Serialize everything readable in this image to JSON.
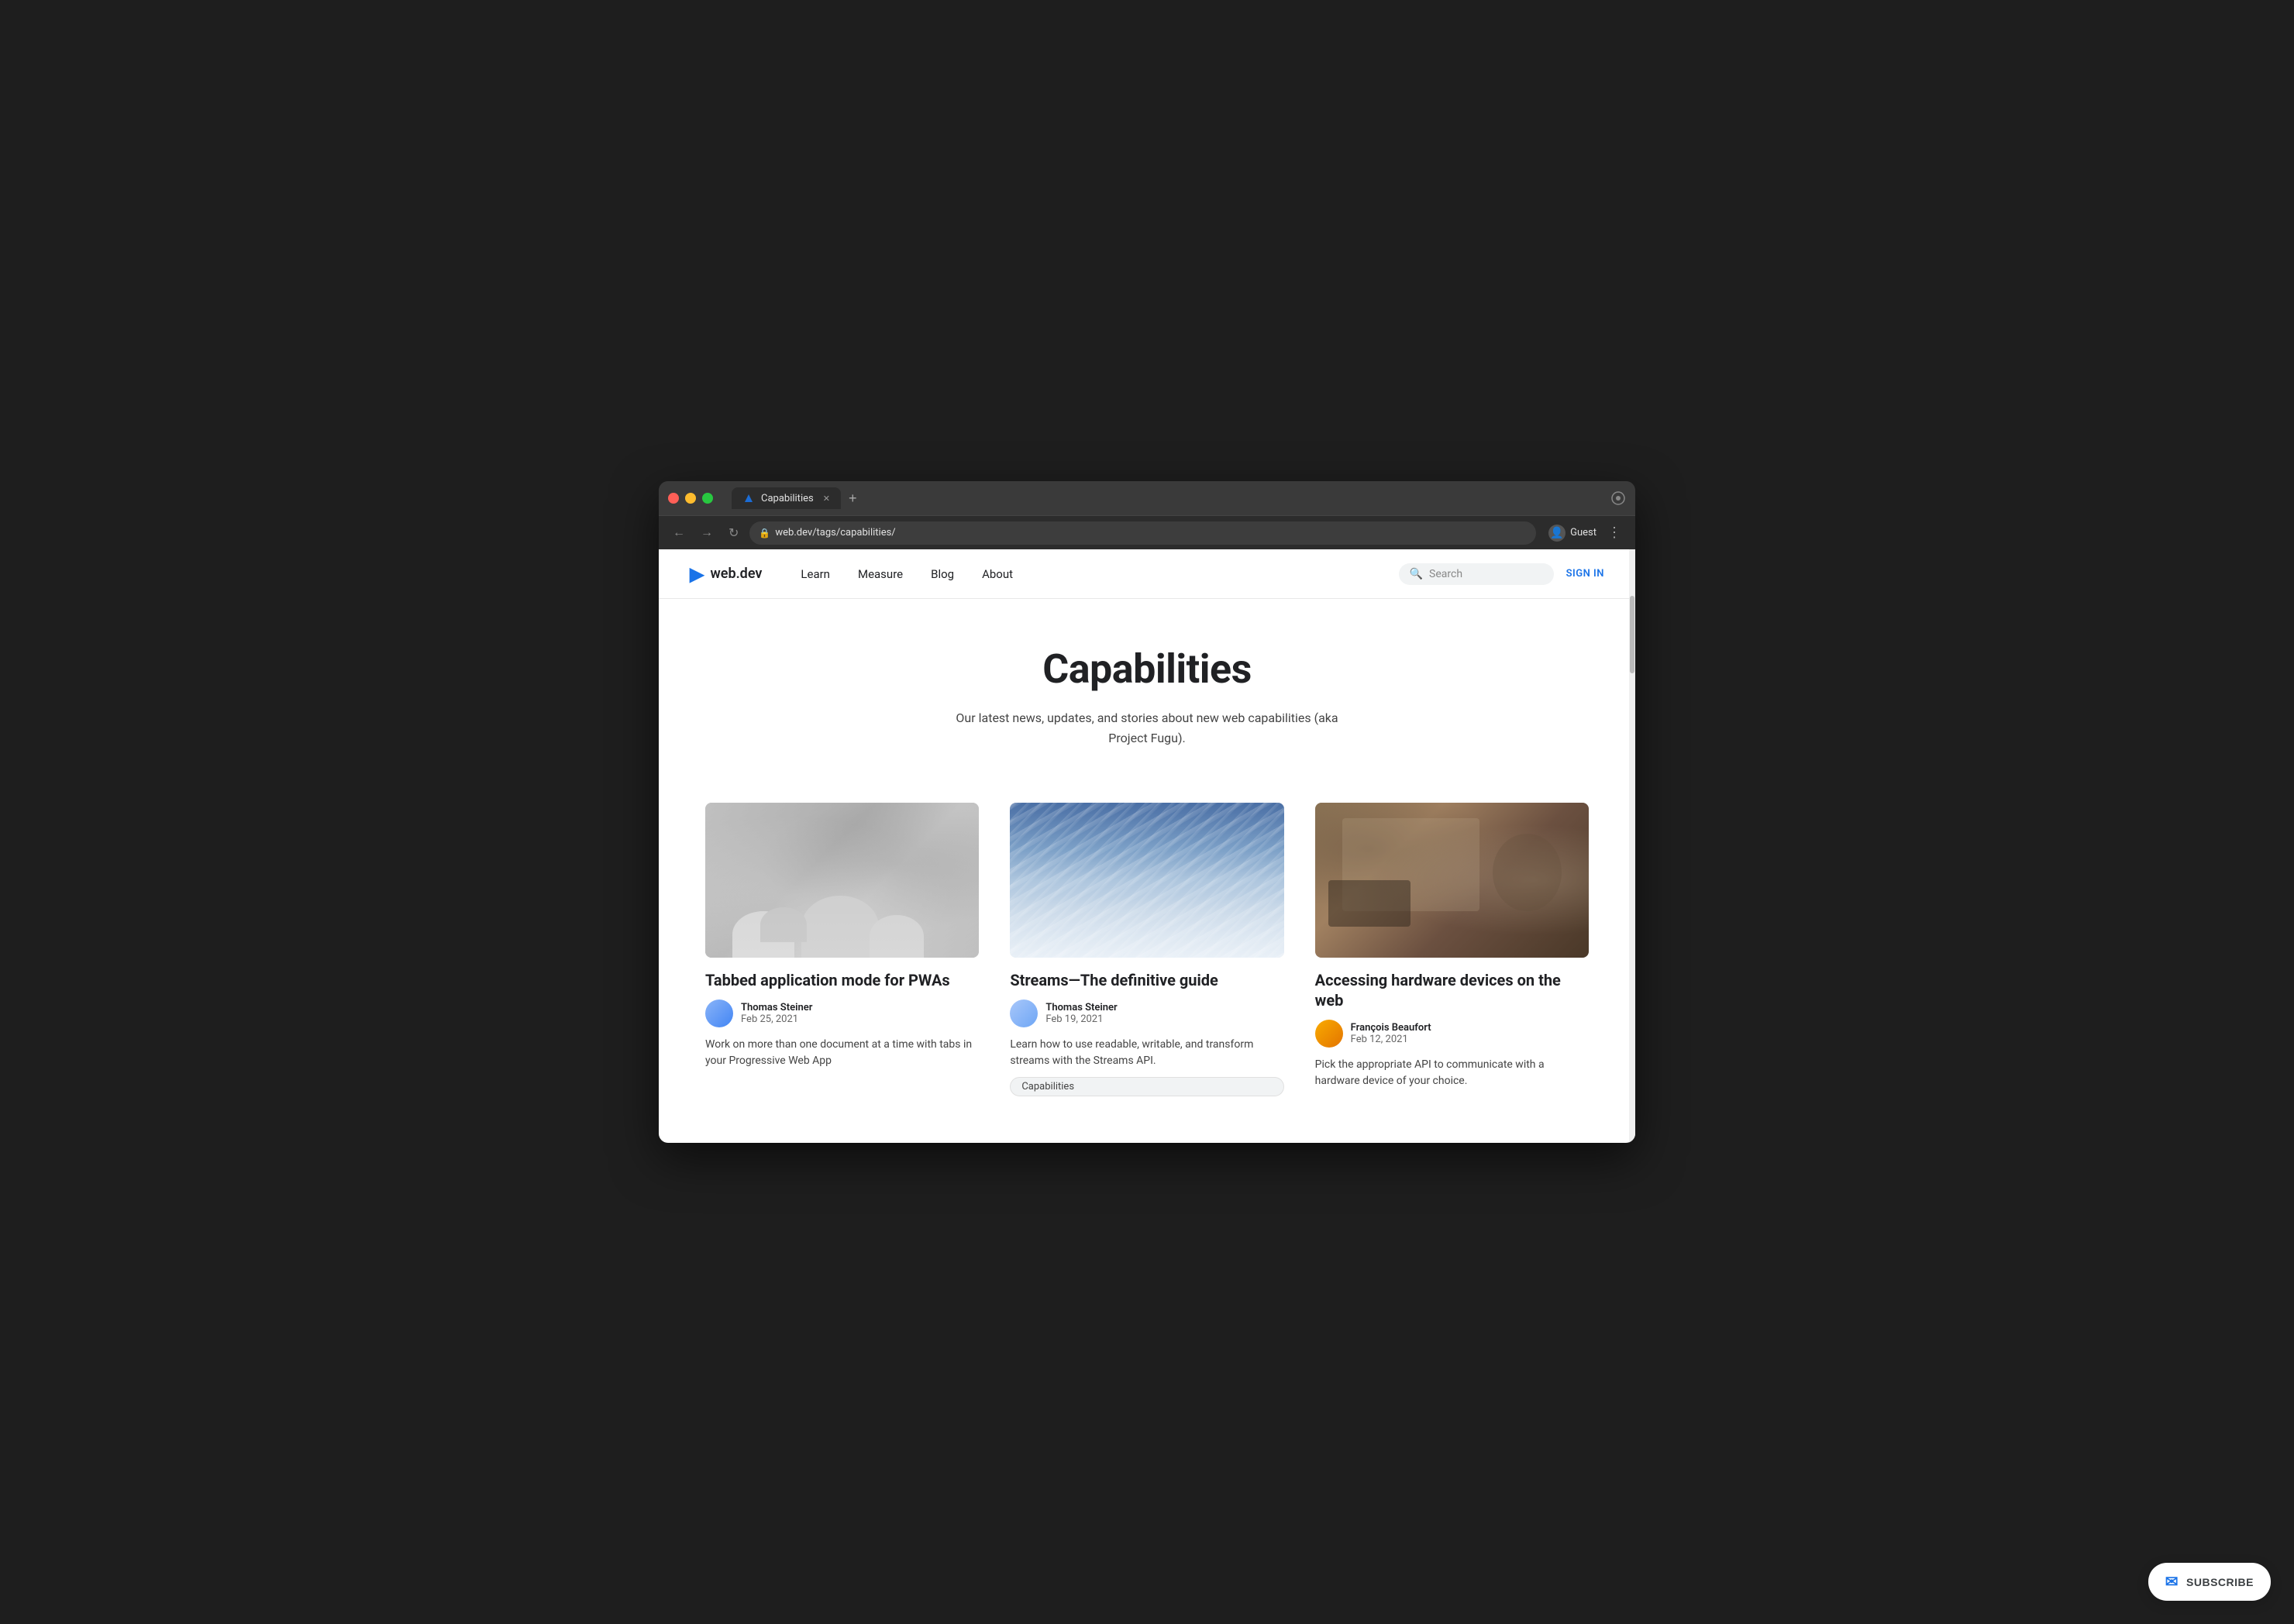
{
  "browser": {
    "tab_title": "Capabilities",
    "tab_new_label": "+",
    "url": "web.dev/tags/capabilities/",
    "profile_label": "Guest",
    "nav_back": "←",
    "nav_forward": "→",
    "nav_refresh": "↻"
  },
  "site": {
    "logo_text": "web.dev",
    "nav": {
      "items": [
        {
          "label": "Learn",
          "href": "#"
        },
        {
          "label": "Measure",
          "href": "#"
        },
        {
          "label": "Blog",
          "href": "#"
        },
        {
          "label": "About",
          "href": "#"
        }
      ]
    },
    "search_placeholder": "Search",
    "sign_in_label": "SIGN IN"
  },
  "hero": {
    "title": "Capabilities",
    "description": "Our latest news, updates, and stories about new web capabilities (aka Project Fugu)."
  },
  "articles": [
    {
      "title": "Tabbed application mode for PWAs",
      "author_name": "Thomas Steiner",
      "author_date": "Feb 25, 2021",
      "excerpt": "Work on more than one document at a time with tabs in your Progressive Web App",
      "tag": null
    },
    {
      "title": "Streams—The definitive guide",
      "author_name": "Thomas Steiner",
      "author_date": "Feb 19, 2021",
      "excerpt": "Learn how to use readable, writable, and transform streams with the Streams API.",
      "tag": "Capabilities"
    },
    {
      "title": "Accessing hardware devices on the web",
      "author_name": "François Beaufort",
      "author_date": "Feb 12, 2021",
      "excerpt": "Pick the appropriate API to communicate with a hardware device of your choice.",
      "tag": null
    }
  ],
  "subscribe": {
    "label": "SUBSCRIBE",
    "icon": "✉"
  }
}
